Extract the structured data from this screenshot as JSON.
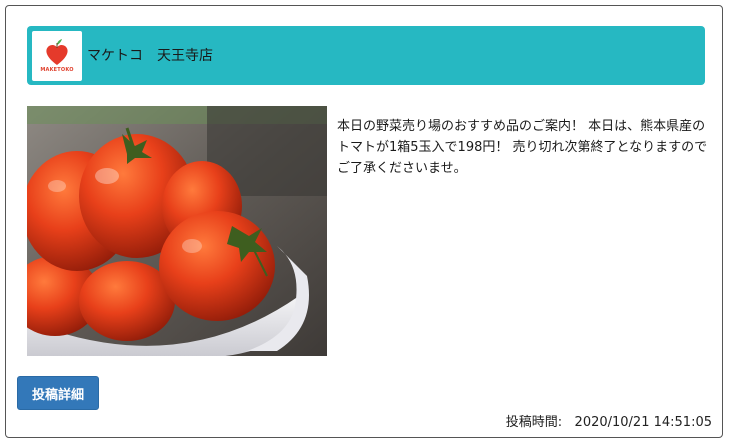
{
  "header": {
    "store_name": "マケトコ　天王寺店",
    "logo_text": "MAKETOKO",
    "logo_icon": "heart-apple-icon",
    "background_color": "#26b8c2"
  },
  "post": {
    "image": "tomatoes-in-bowl-photo",
    "text": "本日の野菜売り場のおすすめ品のご案内！ 本日は、熊本県産のトマトが1箱5玉入で198円！ 売り切れ次第終了となりますのでご了承くださいませ。",
    "detail_button_label": "投稿詳細",
    "button_color": "#3378b9",
    "time_label": "投稿時間:",
    "time_value": "2020/10/21 14:51:05"
  }
}
